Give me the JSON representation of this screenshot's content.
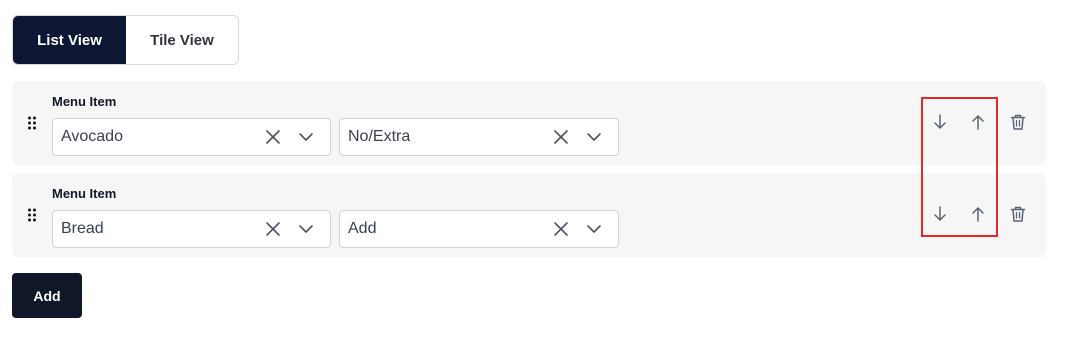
{
  "view_toggle": {
    "list_label": "List View",
    "tile_label": "Tile View",
    "active": "list"
  },
  "rows": [
    {
      "label": "Menu Item",
      "item_value": "Avocado",
      "modifier_value": "No/Extra"
    },
    {
      "label": "Menu Item",
      "item_value": "Bread",
      "modifier_value": "Add"
    }
  ],
  "add_button": {
    "label": "Add"
  },
  "icons": {
    "drag": "drag-handle-icon",
    "clear": "close-icon",
    "chevron": "chevron-down-icon",
    "down": "arrow-down-icon",
    "up": "arrow-up-icon",
    "delete": "trash-icon"
  },
  "colors": {
    "primary_dark": "#0d1733",
    "row_background": "#f6f6f7",
    "highlight": "#e5262b"
  }
}
